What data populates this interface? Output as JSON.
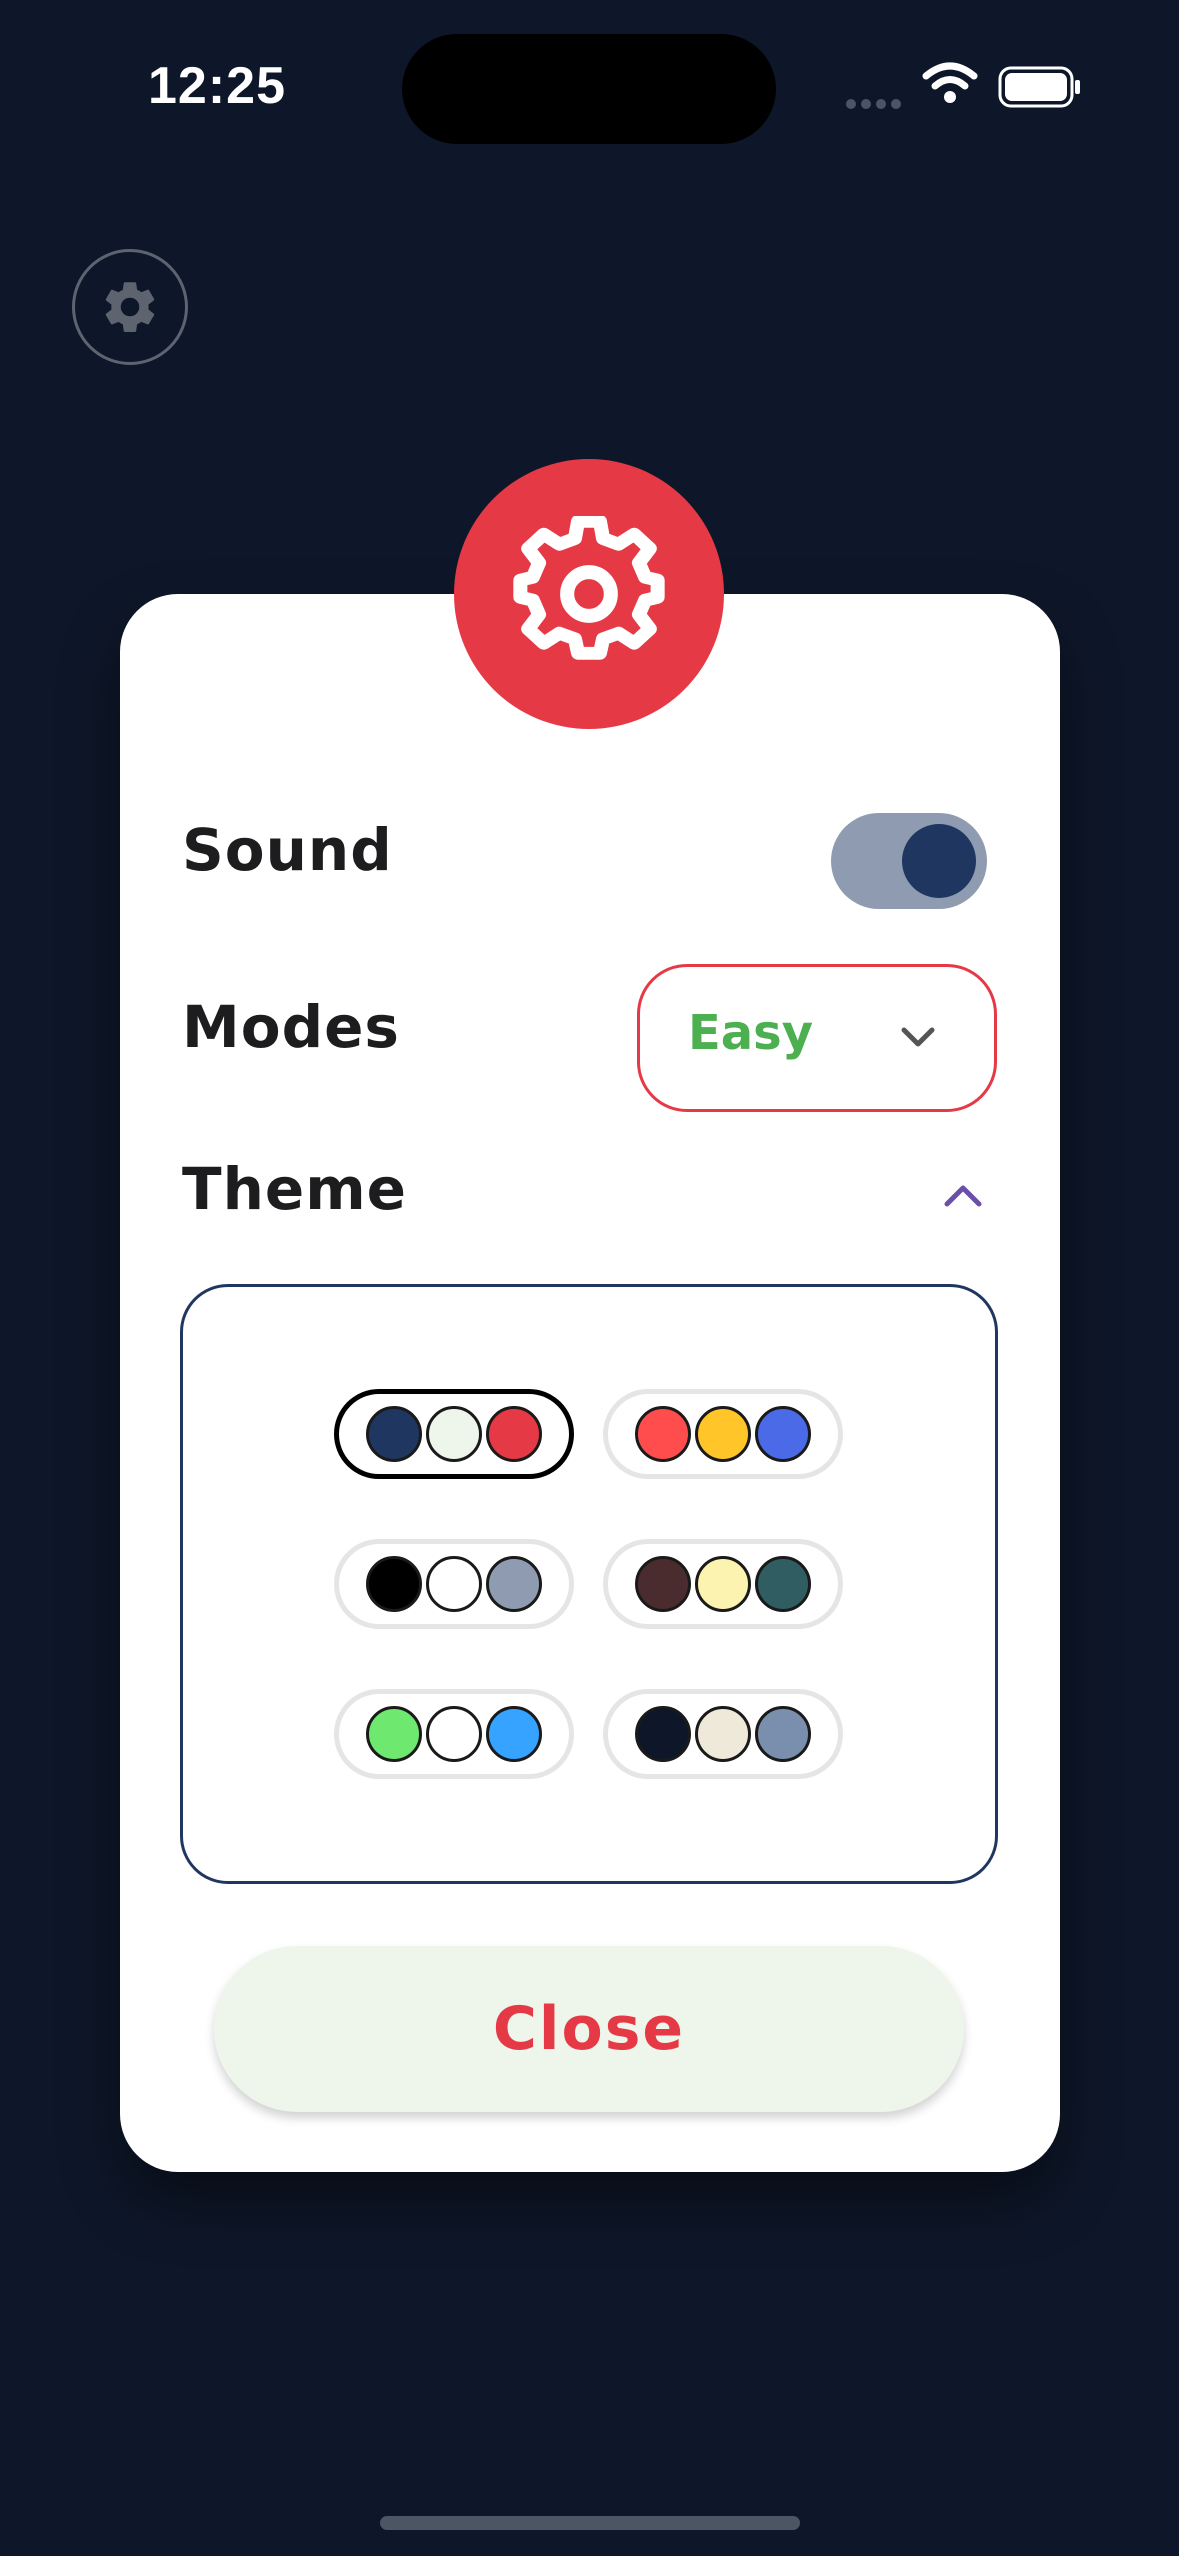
{
  "status_bar": {
    "time": "12:25"
  },
  "settings_modal": {
    "sound_label": "Sound",
    "sound_enabled": true,
    "modes_label": "Modes",
    "mode_value": "Easy",
    "theme_label": "Theme",
    "theme_expanded": true,
    "themes": [
      {
        "colors": [
          "#1f3760",
          "#eef6eb",
          "#e63946"
        ],
        "selected": true
      },
      {
        "colors": [
          "#ff4d4d",
          "#ffc529",
          "#4a6ae8"
        ],
        "selected": false
      },
      {
        "colors": [
          "#000000",
          "#ffffff",
          "#8f9bb0"
        ],
        "selected": false
      },
      {
        "colors": [
          "#4a2c2f",
          "#fdf3b0",
          "#2f5d62"
        ],
        "selected": false
      },
      {
        "colors": [
          "#6ee86e",
          "#ffffff",
          "#35a3ff"
        ],
        "selected": false
      },
      {
        "colors": [
          "#0e1729",
          "#efe9da",
          "#7a8fae"
        ],
        "selected": false
      }
    ],
    "close_label": "Close"
  },
  "colors": {
    "background": "#0e1729",
    "accent": "#e63946",
    "primary": "#1f3760",
    "mode_text": "#4caf50"
  },
  "icons": {
    "top_button": "gear-icon",
    "badge": "gear-icon",
    "dropdown": "chevron-down-icon",
    "theme_toggle": "chevron-up-icon"
  }
}
